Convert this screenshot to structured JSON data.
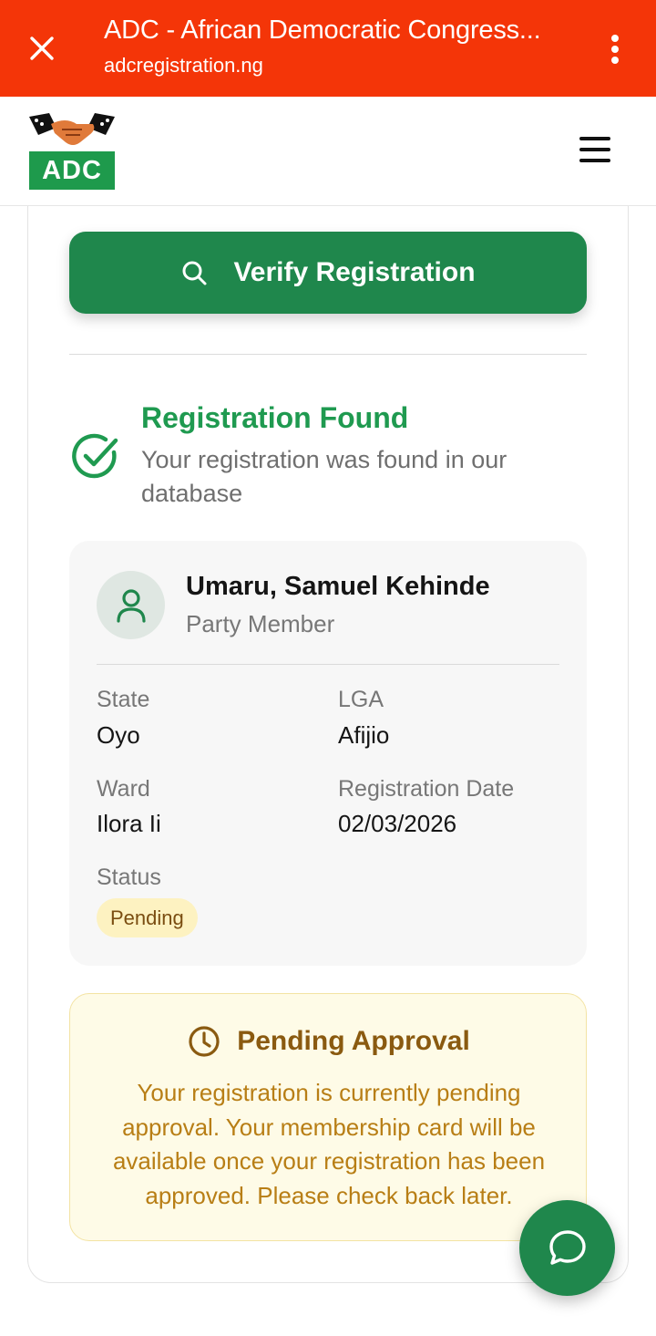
{
  "browser": {
    "title": "ADC - African Democratic Congress...",
    "url": "adcregistration.ng"
  },
  "header": {
    "logo_text": "ADC"
  },
  "verify": {
    "button_label": "Verify Registration"
  },
  "result": {
    "title": "Registration Found",
    "subtitle": "Your registration was found in our database"
  },
  "member": {
    "name": "Umaru, Samuel Kehinde",
    "role": "Party Member",
    "fields": {
      "state_label": "State",
      "state_value": "Oyo",
      "lga_label": "LGA",
      "lga_value": "Afijio",
      "ward_label": "Ward",
      "ward_value": "Ilora Ii",
      "date_label": "Registration Date",
      "date_value": "02/03/2026",
      "status_label": "Status",
      "status_value": "Pending"
    }
  },
  "pending": {
    "title": "Pending Approval",
    "text": "Your registration is currently pending approval. Your membership card will be available once your registration has been approved. Please check back later."
  },
  "colors": {
    "browser_bar": "#f43508",
    "brand_green": "#1f874c",
    "success_green": "#1f9a50",
    "pending_bg": "#fefbe7",
    "pending_text": "#b87e15"
  },
  "icons": {
    "close": "close-icon",
    "menu": "more-vert-icon",
    "hamburger": "hamburger-menu-icon",
    "search": "search-icon",
    "check": "check-circle-icon",
    "user": "user-icon",
    "clock": "clock-icon",
    "chat": "chat-bubble-icon"
  }
}
